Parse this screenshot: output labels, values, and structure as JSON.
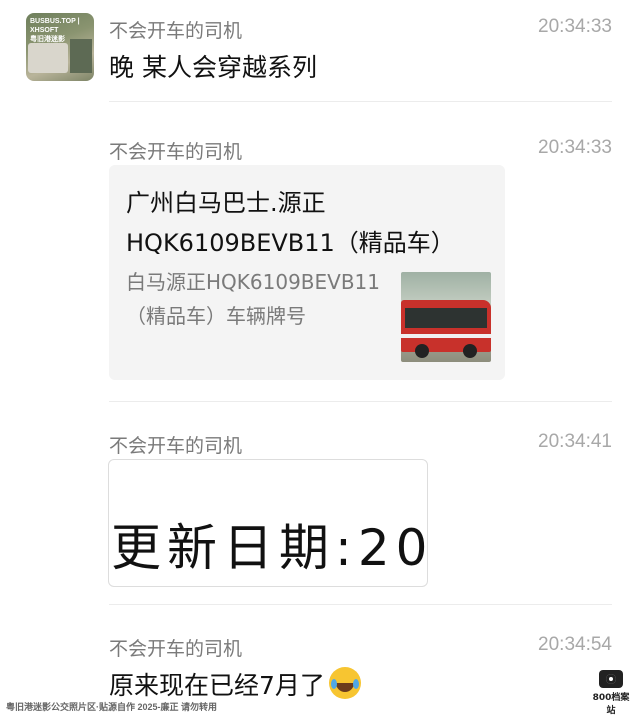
{
  "avatar": {
    "watermark": "BUSBUS.TOP | XHSOFT",
    "sub": "粤旧港迷影"
  },
  "messages": [
    {
      "sender": "不会开车的司机",
      "time": "20:34:33",
      "text": "晚 某人会穿越系列"
    },
    {
      "sender": "不会开车的司机",
      "time": "20:34:33",
      "card": {
        "title": "广州白马巴士.源正HQK6109BEVB11（精品车）",
        "description": "白马源正HQK6109BEVB11（精品车）车辆牌号"
      }
    },
    {
      "sender": "不会开车的司机",
      "time": "20:34:41",
      "image_text": "更新日期:20"
    },
    {
      "sender": "不会开车的司机",
      "time": "20:34:54",
      "text": "原来现在已经7月了",
      "emoji": "laughing-with-tears-emoji"
    }
  ],
  "watermarks": {
    "bottom_left": "粤旧港迷影公交照片区·贴源自作 2025-廉正 请勿转用",
    "bottom_right": "800档案站"
  }
}
